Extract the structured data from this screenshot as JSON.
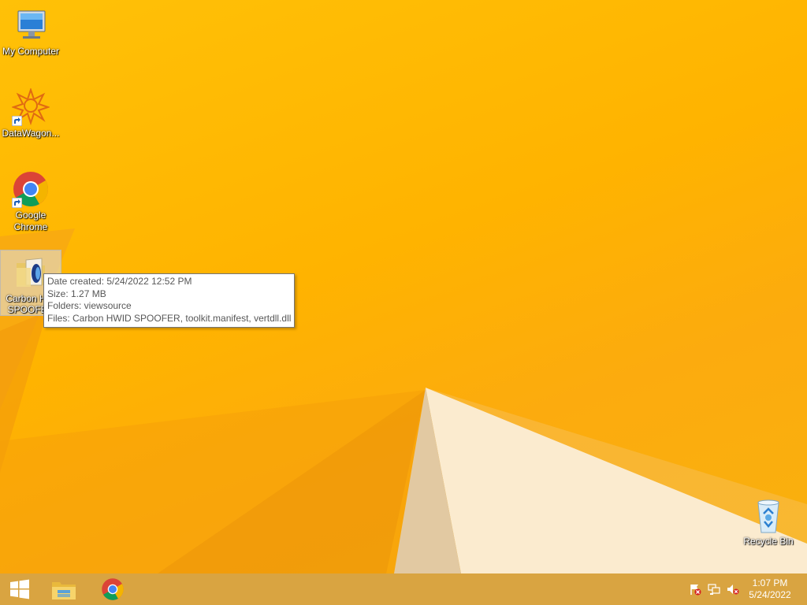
{
  "desktop": {
    "icons": [
      {
        "label": "My Computer",
        "icon": "computer-icon"
      },
      {
        "label": "DataWagon...",
        "icon": "datawagon-icon"
      },
      {
        "label": "Google Chrome",
        "icon": "chrome-icon"
      },
      {
        "label": "Carbon HWID SPOOFER",
        "label_visible": "Carbon H… SPOOFER",
        "icon": "folder-icon"
      },
      {
        "label": "Recycle Bin",
        "icon": "recycle-bin-icon"
      }
    ]
  },
  "tooltip": {
    "date_created": "Date created: 5/24/2022 12:52 PM",
    "size": "Size: 1.27 MB",
    "folders": "Folders: viewsource",
    "files": "Files: Carbon HWID SPOOFER, toolkit.manifest, vertdll.dll"
  },
  "taskbar": {
    "start_icon": "windows-logo-icon",
    "pinned": [
      "file-explorer-icon",
      "chrome-icon"
    ],
    "tray_icons": [
      "action-center-flag-icon",
      "network-icon",
      "volume-muted-icon"
    ],
    "clock_time": "1:07 PM",
    "clock_date": "5/24/2022"
  },
  "colors": {
    "wallpaper": "#FFB300",
    "taskbar": "#D9A441"
  }
}
